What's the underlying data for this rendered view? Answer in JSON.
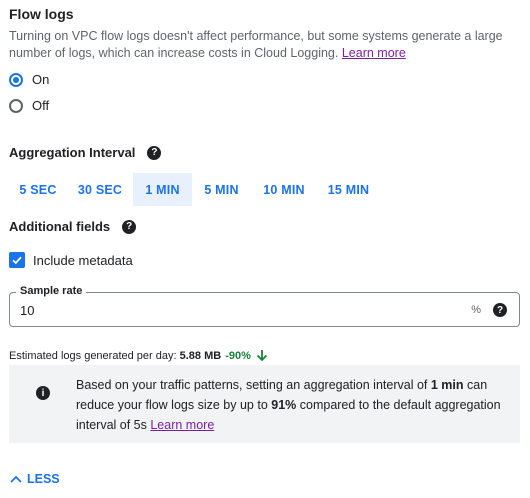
{
  "flow_logs": {
    "title": "Flow logs",
    "description": "Turning on VPC flow logs doesn't affect performance, but some systems generate a large number of logs, which can increase costs in Cloud Logging.",
    "learn_more": "Learn more",
    "options": [
      {
        "label": "On",
        "checked": true
      },
      {
        "label": "Off",
        "checked": false
      }
    ]
  },
  "aggregation": {
    "title": "Aggregation Interval",
    "intervals": [
      "5 SEC",
      "30 SEC",
      "1 MIN",
      "5 MIN",
      "10 MIN",
      "15 MIN"
    ],
    "selected": "1 MIN"
  },
  "additional_fields": {
    "title": "Additional fields",
    "include_metadata_label": "Include metadata",
    "include_metadata_checked": true
  },
  "sample_rate": {
    "label": "Sample rate",
    "value": "10",
    "suffix": "%"
  },
  "estimate": {
    "prefix": "Estimated logs generated per day: ",
    "value": "5.88 MB",
    "change": "-90%"
  },
  "info": {
    "text_1": "Based on your traffic patterns, setting an aggregation interval of ",
    "interval": "1 min",
    "text_2": " can reduce your flow logs size by up to ",
    "reduction": "91%",
    "text_3": " compared to the default aggregation interval of 5s ",
    "learn_more": "Learn more"
  },
  "less_label": "LESS",
  "colors": {
    "accent": "#1a73e8",
    "link": "#7b1fa2",
    "positive": "#188038",
    "info_bg": "#f1f3f4"
  }
}
